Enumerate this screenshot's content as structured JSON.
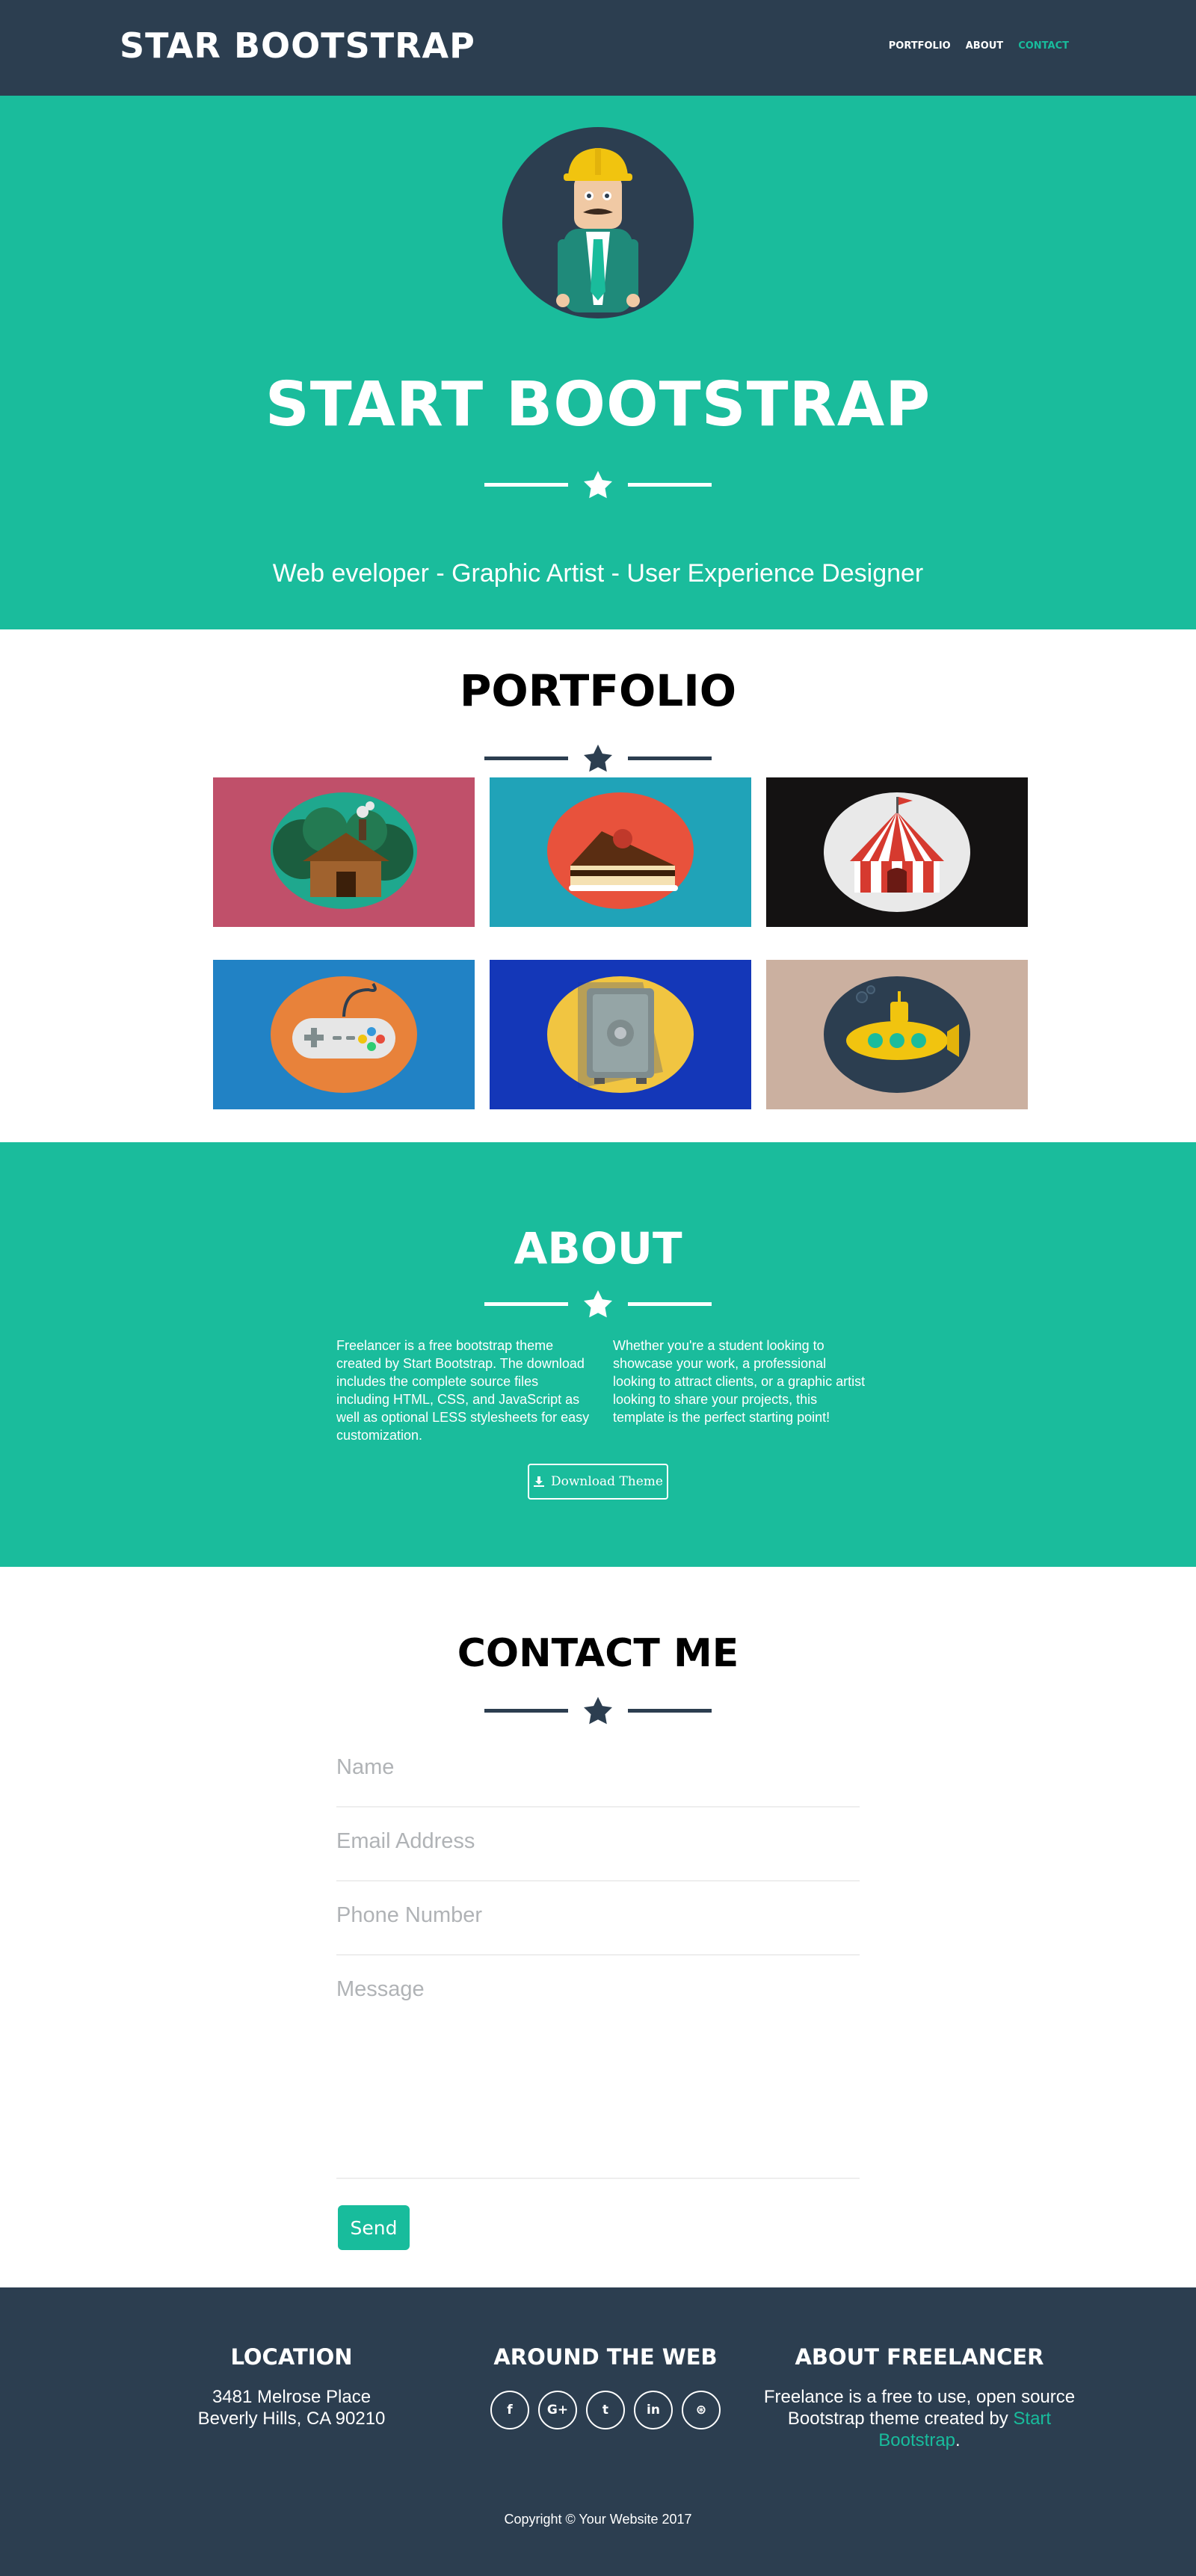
{
  "navbar": {
    "brand": "STAR BOOTSTRAP",
    "links": [
      {
        "label": "PORTFOLIO",
        "active": false
      },
      {
        "label": "ABOUT",
        "active": false
      },
      {
        "label": "CONTACT",
        "active": true
      }
    ]
  },
  "hero": {
    "title": "START BOOTSTRAP",
    "subtitle": "Web eveloper - Graphic Artist - User Experience Designer",
    "avatar_icon": "avatar-icon"
  },
  "portfolio": {
    "title": "PORTFOLIO",
    "items": [
      {
        "icon": "cabin-icon",
        "bg": "#c0506a"
      },
      {
        "icon": "cake-icon",
        "bg": "#20a3b8"
      },
      {
        "icon": "circus-tent-icon",
        "bg": "#141212"
      },
      {
        "icon": "game-controller-icon",
        "bg": "#2182c5"
      },
      {
        "icon": "safe-icon",
        "bg": "#1437b8"
      },
      {
        "icon": "submarine-icon",
        "bg": "#cbb0a0"
      }
    ]
  },
  "about": {
    "title": "ABOUT",
    "left_text": "Freelancer is a free bootstrap theme created by Start Bootstrap. The download includes the complete source files including HTML, CSS, and JavaScript as well as optional LESS stylesheets for easy customization.",
    "right_text": "Whether you're a student looking to showcase your work, a professional looking to attract clients, or a graphic artist looking to share your projects, this template is the perfect starting point!",
    "download_label": "Download Theme"
  },
  "contact": {
    "title": "CONTACT ME",
    "name_placeholder": "Name",
    "email_placeholder": "Email Address",
    "phone_placeholder": "Phone Number",
    "message_placeholder": "Message",
    "send_label": "Send"
  },
  "footer": {
    "location": {
      "heading": "LOCATION",
      "line1": "3481 Melrose Place",
      "line2": "Beverly Hills, CA 90210"
    },
    "web": {
      "heading": "AROUND THE WEB",
      "socials": [
        {
          "icon": "facebook-icon",
          "glyph": "f"
        },
        {
          "icon": "google-plus-icon",
          "glyph": "G+"
        },
        {
          "icon": "twitter-icon",
          "glyph": "t"
        },
        {
          "icon": "linkedin-icon",
          "glyph": "in"
        },
        {
          "icon": "dribbble-icon",
          "glyph": "⊛"
        }
      ]
    },
    "about": {
      "heading": "ABOUT FREELANCER",
      "text_before": "Freelance is a free to use, open source Bootstrap theme created by",
      "link": "Start Bootstrap",
      "text_after": "."
    },
    "copyright": "Copyright © Your Website 2017"
  },
  "colors": {
    "navy": "#2c3e50",
    "teal": "#1abc9c",
    "accent": "#18bc9c"
  }
}
